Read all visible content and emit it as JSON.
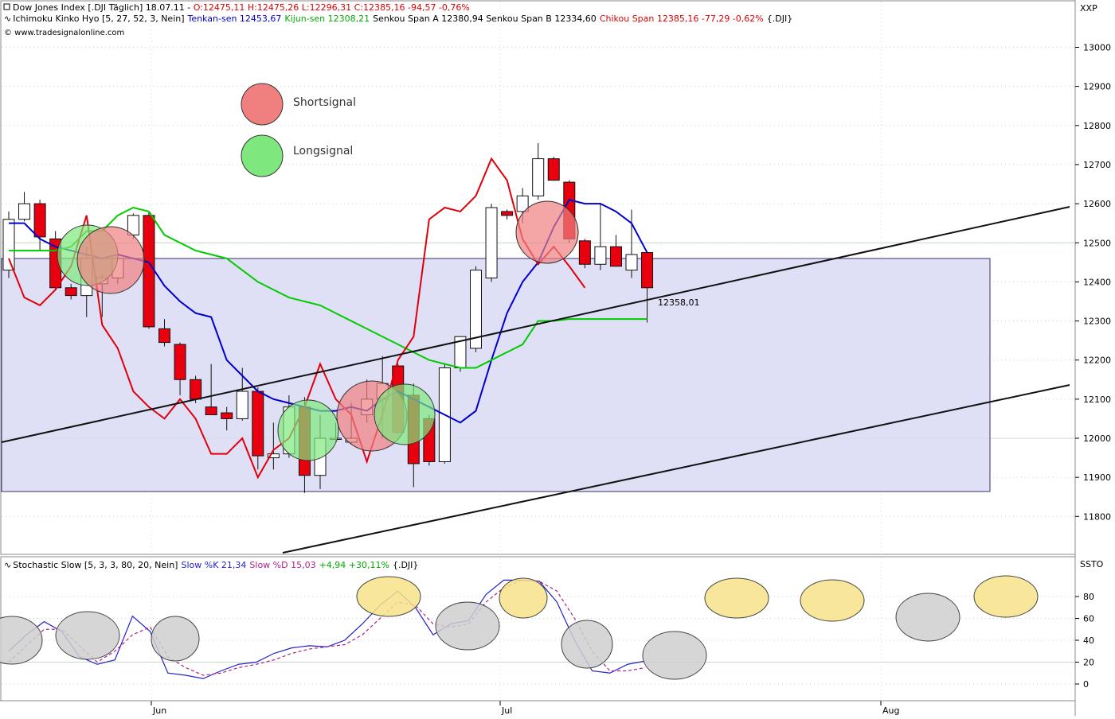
{
  "header": {
    "symbol_prefix": "Dow Jones Index [.DJI  Täglich] 18.07.11 - ",
    "ohlc": "O:12475,11 H:12475,26 L:12296,31 C:12385,16 -94,57 -0,76%",
    "ichi_params": "Ichimoku Kinko Hyo [5, 27, 52, 3, Nein]",
    "tenkan": "Tenkan-sen 12453,67",
    "kijun": "Kijun-sen 12308,21",
    "senkou": "Senkou Span A 12380,94 Senkou Span B 12334,60",
    "chikou": "Chikou Span 12385,16 -77,29 -0,62%",
    "ticker_suffix": "{.DJI}",
    "copyright": "© www.tradesignalonline.com",
    "axis_badge_main": "XXP",
    "stoch_params": "Stochastic Slow [5, 3, 3, 80, 20, Nein]",
    "stoch_k": "Slow %K 21,34",
    "stoch_d": "Slow %D 15,03",
    "stoch_change": "+4,94 +30,11%",
    "axis_badge_stoch": "SSTO"
  },
  "legend": {
    "short_label": "Shortsignal",
    "long_label": "Longsignal"
  },
  "price_marker": "12358,01",
  "x_labels": [
    "Jun",
    "Jul",
    "Aug"
  ],
  "colors": {
    "bull_body": "#ffffff",
    "bear_body": "#e8000e",
    "tenkan": "#0000cc",
    "kijun": "#00cc00",
    "chikou": "#e0000a",
    "box_fill": "#dcdcf4",
    "short_signal": "#f08080",
    "long_signal": "#7ee87e",
    "stoch_k": "#2222cc",
    "stoch_d": "#aa2288",
    "ellipse_yellow": "#f7e38a",
    "ellipse_gray": "#cfcfcf"
  },
  "chart_data": [
    {
      "type": "candlestick",
      "title": "Dow Jones Index",
      "y_ticks": [
        11800,
        11900,
        12000,
        12100,
        12200,
        12300,
        12400,
        12500,
        12600,
        12700,
        12800,
        12900,
        13000
      ],
      "ylim": [
        11700,
        13100
      ],
      "x_ticks": [
        "Jun",
        "Jul",
        "Aug"
      ],
      "candles": [
        {
          "o": 12430,
          "h": 12580,
          "l": 12410,
          "c": 12560
        },
        {
          "o": 12560,
          "h": 12630,
          "l": 12555,
          "c": 12600
        },
        {
          "o": 12600,
          "h": 12610,
          "l": 12480,
          "c": 12515
        },
        {
          "o": 12510,
          "h": 12530,
          "l": 12380,
          "c": 12385
        },
        {
          "o": 12385,
          "h": 12395,
          "l": 12355,
          "c": 12365
        },
        {
          "o": 12365,
          "h": 12490,
          "l": 12310,
          "c": 12460
        },
        {
          "o": 12395,
          "h": 12420,
          "l": 12310,
          "c": 12410
        },
        {
          "o": 12410,
          "h": 12470,
          "l": 12395,
          "c": 12460
        },
        {
          "o": 12520,
          "h": 12575,
          "l": 12510,
          "c": 12570
        },
        {
          "o": 12570,
          "h": 12580,
          "l": 12280,
          "c": 12285
        },
        {
          "o": 12280,
          "h": 12305,
          "l": 12235,
          "c": 12245
        },
        {
          "o": 12240,
          "h": 12245,
          "l": 12110,
          "c": 12150
        },
        {
          "o": 12150,
          "h": 12160,
          "l": 12090,
          "c": 12100
        },
        {
          "o": 12080,
          "h": 12190,
          "l": 12065,
          "c": 12060
        },
        {
          "o": 12065,
          "h": 12080,
          "l": 12020,
          "c": 12050
        },
        {
          "o": 12050,
          "h": 12180,
          "l": 12045,
          "c": 12120
        },
        {
          "o": 12120,
          "h": 12130,
          "l": 11920,
          "c": 11955
        },
        {
          "o": 11950,
          "h": 12040,
          "l": 11920,
          "c": 11960
        },
        {
          "o": 11960,
          "h": 12110,
          "l": 11950,
          "c": 12080
        },
        {
          "o": 12080,
          "h": 12105,
          "l": 11860,
          "c": 11905
        },
        {
          "o": 11905,
          "h": 12060,
          "l": 11870,
          "c": 12000
        },
        {
          "o": 12000,
          "h": 12040,
          "l": 11990,
          "c": 12000
        },
        {
          "o": 11990,
          "h": 12090,
          "l": 11985,
          "c": 12000
        },
        {
          "o": 12060,
          "h": 12150,
          "l": 12040,
          "c": 12100
        },
        {
          "o": 12100,
          "h": 12210,
          "l": 12000,
          "c": 12140
        },
        {
          "o": 12185,
          "h": 12190,
          "l": 12010,
          "c": 12015
        },
        {
          "o": 12110,
          "h": 12140,
          "l": 11875,
          "c": 11935
        },
        {
          "o": 12050,
          "h": 12060,
          "l": 11930,
          "c": 11940
        },
        {
          "o": 11940,
          "h": 12190,
          "l": 11935,
          "c": 12180
        },
        {
          "o": 12180,
          "h": 12240,
          "l": 12170,
          "c": 12260
        },
        {
          "o": 12230,
          "h": 12440,
          "l": 12220,
          "c": 12430
        },
        {
          "o": 12410,
          "h": 12600,
          "l": 12400,
          "c": 12590
        },
        {
          "o": 12580,
          "h": 12585,
          "l": 12560,
          "c": 12570
        },
        {
          "o": 12580,
          "h": 12640,
          "l": 12550,
          "c": 12620
        },
        {
          "o": 12620,
          "h": 12755,
          "l": 12610,
          "c": 12715
        },
        {
          "o": 12715,
          "h": 12720,
          "l": 12660,
          "c": 12660
        },
        {
          "o": 12655,
          "h": 12660,
          "l": 12500,
          "c": 12510
        },
        {
          "o": 12505,
          "h": 12510,
          "l": 12435,
          "c": 12445
        },
        {
          "o": 12445,
          "h": 12600,
          "l": 12430,
          "c": 12490
        },
        {
          "o": 12490,
          "h": 12520,
          "l": 12445,
          "c": 12440
        },
        {
          "o": 12430,
          "h": 12585,
          "l": 12410,
          "c": 12470
        },
        {
          "o": 12475,
          "h": 12475,
          "l": 12296,
          "c": 12385
        }
      ],
      "series": [
        {
          "name": "Tenkan-sen",
          "values": [
            12550,
            12550,
            12510,
            12490,
            12480,
            12470,
            12460,
            12470,
            12460,
            12450,
            12390,
            12350,
            12320,
            12310,
            12200,
            12160,
            12120,
            12100,
            12090,
            12080,
            12070,
            12070,
            12080,
            12070,
            12100,
            12120,
            12100,
            12080,
            12060,
            12040,
            12070,
            12200,
            12320,
            12400,
            12450,
            12540,
            12610,
            12600,
            12600,
            12580,
            12550,
            12475
          ]
        },
        {
          "name": "Kijun-sen",
          "values": [
            12480,
            12480,
            12480,
            12480,
            12490,
            12530,
            12530,
            12570,
            12590,
            12580,
            12520,
            12500,
            12480,
            12470,
            12460,
            12430,
            12400,
            12380,
            12360,
            12350,
            12340,
            12320,
            12300,
            12280,
            12260,
            12240,
            12220,
            12200,
            12190,
            12180,
            12180,
            12200,
            12220,
            12240,
            12300,
            12300,
            12305,
            12305,
            12305,
            12305,
            12305,
            12305
          ]
        },
        {
          "name": "Chikou Span",
          "values": [
            12460,
            12360,
            12340,
            12380,
            12440,
            12570,
            12290,
            12230,
            12120,
            12080,
            12050,
            12100,
            12050,
            11960,
            11960,
            12000,
            11900,
            11970,
            12000,
            12080,
            12190,
            12100,
            12060,
            11940,
            12060,
            12200,
            12260,
            12560,
            12590,
            12580,
            12620,
            12715,
            12660,
            12510,
            12445,
            12490,
            12440,
            12385
          ]
        }
      ]
    },
    {
      "type": "line",
      "title": "Stochastic Slow",
      "y_ticks": [
        0,
        20,
        40,
        60,
        80
      ],
      "ylim": [
        -15,
        105
      ],
      "series": [
        {
          "name": "Slow %K",
          "values": [
            30,
            45,
            57,
            48,
            25,
            18,
            22,
            62,
            48,
            10,
            8,
            5,
            12,
            18,
            20,
            28,
            33,
            35,
            34,
            40,
            55,
            72,
            85,
            70,
            45,
            55,
            58,
            82,
            95,
            95,
            94,
            75,
            40,
            12,
            10,
            18,
            21
          ]
        },
        {
          "name": "Slow %D",
          "values": [
            20,
            35,
            50,
            50,
            35,
            20,
            30,
            45,
            52,
            25,
            15,
            8,
            10,
            15,
            18,
            22,
            28,
            32,
            34,
            36,
            45,
            60,
            75,
            72,
            55,
            52,
            55,
            75,
            88,
            95,
            94,
            85,
            60,
            30,
            12,
            12,
            15
          ]
        }
      ]
    }
  ]
}
